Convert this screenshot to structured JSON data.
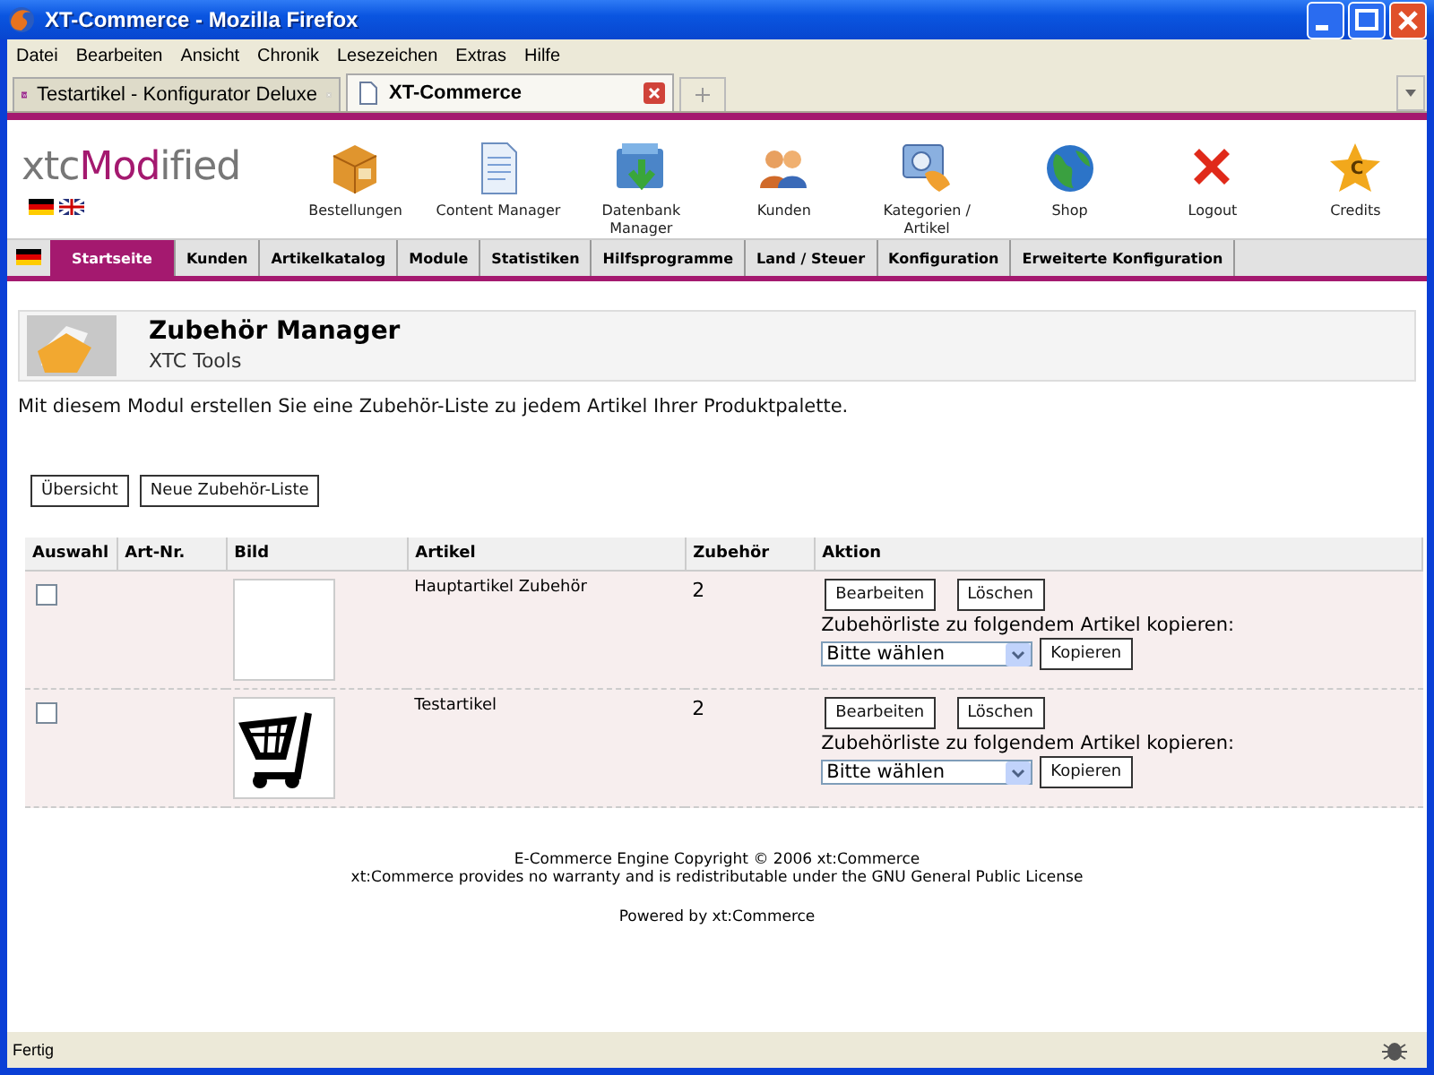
{
  "window": {
    "title": "XT-Commerce - Mozilla Firefox"
  },
  "menu": [
    "Datei",
    "Bearbeiten",
    "Ansicht",
    "Chronik",
    "Lesezeichen",
    "Extras",
    "Hilfe"
  ],
  "browser_tabs": [
    {
      "label": "Testartikel - Konfigurator Deluxe",
      "selected": false
    },
    {
      "label": "XT-Commerce",
      "selected": true
    }
  ],
  "header": {
    "logo": [
      "xtc",
      "Mod",
      "ified"
    ],
    "toolbar": [
      {
        "kind": "box",
        "label": "Bestellungen"
      },
      {
        "kind": "document",
        "label": "Content Manager"
      },
      {
        "kind": "database",
        "label": "Datenbank Manager"
      },
      {
        "kind": "people",
        "label": "Kunden"
      },
      {
        "kind": "categories",
        "label": "Kategorien / Artikel"
      },
      {
        "kind": "globe",
        "label": "Shop"
      },
      {
        "kind": "cross",
        "label": "Logout"
      },
      {
        "kind": "star",
        "label": "Credits",
        "icon_text": "C"
      }
    ]
  },
  "nav": [
    {
      "label": "Startseite",
      "selected": true
    },
    {
      "label": "Kunden",
      "selected": false
    },
    {
      "label": "Artikelkatalog",
      "selected": false
    },
    {
      "label": "Module",
      "selected": false
    },
    {
      "label": "Statistiken",
      "selected": false
    },
    {
      "label": "Hilfsprogramme",
      "selected": false
    },
    {
      "label": "Land / Steuer",
      "selected": false
    },
    {
      "label": "Konfiguration",
      "selected": false
    },
    {
      "label": "Erweiterte Konfiguration",
      "selected": false
    }
  ],
  "page": {
    "title": "Zubehör Manager",
    "subtitle": "XTC Tools",
    "description": "Mit diesem Modul erstellen Sie eine Zubehör-Liste zu jedem Artikel Ihrer Produktpalette.",
    "buttons": [
      "Übersicht",
      "Neue Zubehör-Liste"
    ]
  },
  "table": {
    "columns": [
      "Auswahl",
      "Art-Nr.",
      "Bild",
      "Artikel",
      "Zubehör",
      "Aktion"
    ],
    "rows": [
      {
        "checked": false,
        "kind": "blank",
        "artikel": "Hauptartikel Zubehör",
        "zubehoer": "2",
        "edit": "Bearbeiten",
        "delete": "Löschen",
        "copy_label": "Zubehörliste zu folgendem Artikel kopieren:",
        "select": "Bitte wählen",
        "copy": "Kopieren"
      },
      {
        "checked": false,
        "kind": "cart",
        "artikel": "Testartikel",
        "zubehoer": "2",
        "edit": "Bearbeiten",
        "delete": "Löschen",
        "copy_label": "Zubehörliste zu folgendem Artikel kopieren:",
        "select": "Bitte wählen",
        "copy": "Kopieren"
      }
    ]
  },
  "footer": [
    "E-Commerce Engine Copyright © 2006 xt:Commerce",
    "xt:Commerce provides no warranty and is redistributable under the GNU General Public License",
    "Powered by xt:Commerce"
  ],
  "status_bar": "Fertig"
}
